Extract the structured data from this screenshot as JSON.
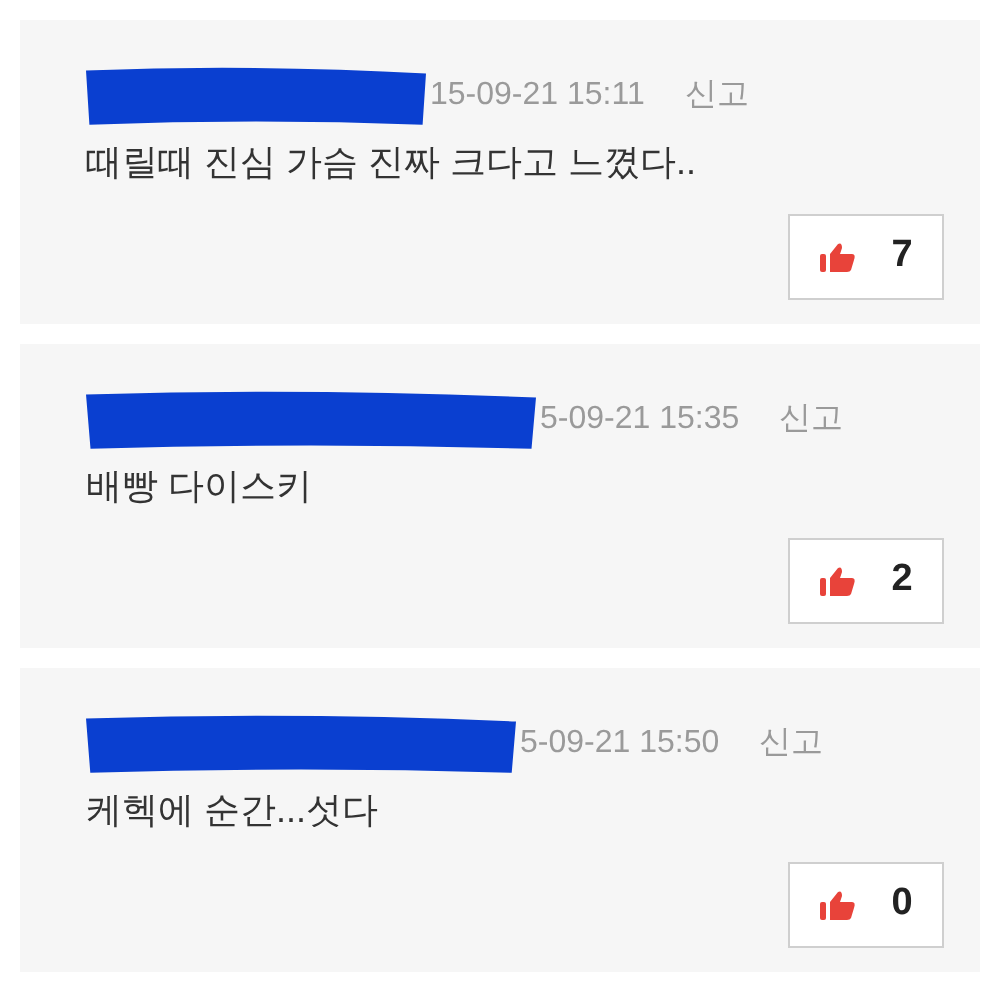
{
  "comments": [
    {
      "timestamp": "15-09-21 15:11",
      "report": "신고",
      "text": "때릴때 진심 가슴 진짜 크다고 느꼈다..",
      "likes": "7"
    },
    {
      "timestamp": "5-09-21 15:35",
      "report": "신고",
      "text": "배빵 다이스키",
      "likes": "2"
    },
    {
      "timestamp": "5-09-21 15:50",
      "report": "신고",
      "text": "케헥에 순간...섯다",
      "likes": "0"
    }
  ]
}
